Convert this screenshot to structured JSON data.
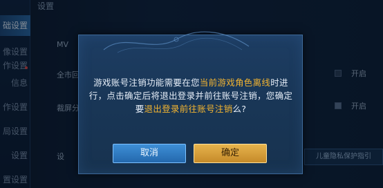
{
  "background": {
    "title": "设置",
    "sidebar_items": [
      "础设置",
      "像设置",
      "作设置",
      "信息",
      "作设置",
      "局设置",
      "设置",
      "置设置"
    ],
    "labels": {
      "mv": "MV",
      "fullscreen": "全市回",
      "frame": "裁屏分",
      "hint": "设"
    },
    "options": {
      "open1": "开启",
      "open2": "开启"
    },
    "bottom_button": "儿童隐私保护指引"
  },
  "dialog": {
    "message_part1": "游戏账号注销功能需要在您",
    "message_hl1": "当前游戏角色离线",
    "message_part2": "时进行，点击确定后将退出登录并前往账号注销，您确定要",
    "message_hl2": "退出登录前往账号注销",
    "message_part3": "么?",
    "cancel_label": "取消",
    "confirm_label": "确定"
  },
  "colors": {
    "highlight": "#f2b431",
    "cancel_button": "#2e7bc4",
    "confirm_button": "#d9a03e"
  }
}
